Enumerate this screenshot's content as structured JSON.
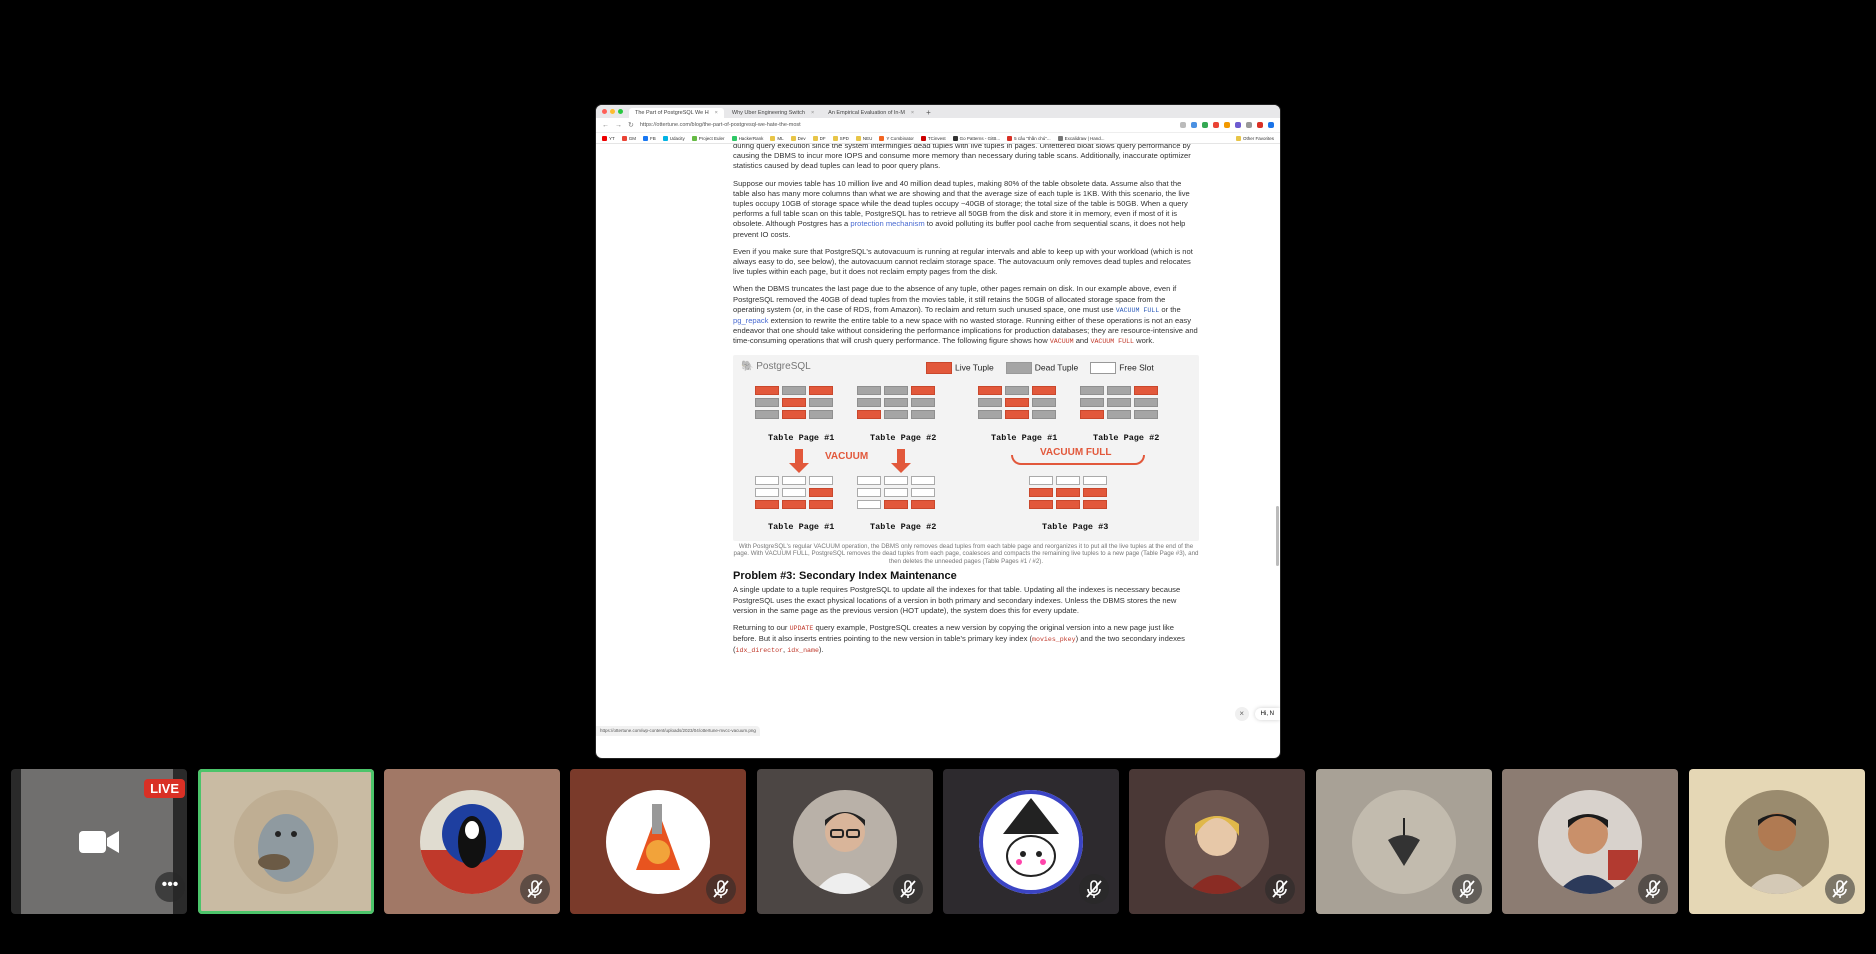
{
  "browser": {
    "tabs": [
      {
        "label": "The Part of PostgreSQL We H",
        "active": true
      },
      {
        "label": "Why Uber Engineering Switch",
        "active": false
      },
      {
        "label": "An Empirical Evaluation of In-M",
        "active": false
      }
    ],
    "new_tab": "+",
    "url": "https://ottertune.com/blog/the-part-of-postgresql-we-hate-the-most",
    "bookmarks": [
      "YT",
      "GM",
      "FB",
      "Udacity",
      "Project Euler",
      "HackerRank",
      "ML",
      "Dev",
      "DF",
      "SPD",
      "NEU",
      "Y Combinator",
      "TCinvest",
      "Go Patterns - GitB...",
      "5 câu \"thần chú\"...",
      "Excalidraw | Hand...",
      "Other Favorites"
    ],
    "status_url": "https://ottertune.com/wp-content/uploads/2023/04/ottertune-mvcc-vacuum.png",
    "toast_text": "Hi, N",
    "toast_close": "×"
  },
  "article": {
    "p1": "during query execution since the system intermingles dead tuples with live tuples in pages. Unfettered bloat slows query performance by causing the DBMS to incur more IOPS and consume more memory than necessary during table scans. Additionally, inaccurate optimizer statistics caused by dead tuples can lead to poor query plans.",
    "p2a": "Suppose our movies table has 10 million live and 40 million dead tuples, making 80% of the table obsolete data. Assume also that the table also has many more columns than what we are showing and that the average size of each tuple is 1KB. With this scenario, the live tuples occupy 10GB of storage space while the dead tuples occupy ~40GB of storage; the total size of the table is 50GB. When a query performs a full table scan on this table, PostgreSQL has to retrieve all 50GB from the disk and store it in memory, even if most of it is obsolete. Although Postgres has a ",
    "p2link": "protection mechanism",
    "p2b": " to avoid polluting its buffer pool cache from sequential scans, it does not help prevent IO costs.",
    "p3": "Even if you make sure that PostgreSQL's autovacuum is running at regular intervals and able to keep up with your workload (which is not always easy to do, see below), the autovacuum cannot reclaim storage space. The autovacuum only removes dead tuples and relocates live tuples within each page, but it does not reclaim empty pages from the disk.",
    "p4a": "When the DBMS truncates the last page due to the absence of any tuple, other pages remain on disk. In our example above, even if PostgreSQL removed the 40GB of dead tuples from the movies table, it still retains the 50GB of allocated storage space from the operating system (or, in the case of RDS, from Amazon). To reclaim and return such unused space, one must use ",
    "p4code1": "VACUUM FULL",
    "p4b": " or the ",
    "p4link": "pg_repack",
    "p4c": " extension to rewrite the entire table to a new space with no wasted storage. Running either of these operations is not an easy endeavor that one should take without considering the performance implications for production databases; they are resource-intensive and time-consuming operations that will crush query performance. The following figure shows how ",
    "p4code2": "VACUUM",
    "p4d": " and ",
    "p4code3": "VACUUM FULL",
    "p4e": " work.",
    "figure": {
      "logo": "PostgreSQL",
      "legend_live": "Live Tuple",
      "legend_dead": "Dead Tuple",
      "legend_free": "Free Slot",
      "label_tp1": "Table Page #1",
      "label_tp2": "Table Page #2",
      "label_tp3": "Table Page #3",
      "vacuum": "VACUUM",
      "vacuum_full": "VACUUM FULL",
      "colors": {
        "live": "#e2583b",
        "dead": "#a5a5a5",
        "free": "#ffffff"
      }
    },
    "caption": "With PostgreSQL's regular VACUUM operation, the DBMS only removes dead tuples from each table page and reorganizes it to put all the live tuples at the end of the page. With VACUUM FULL, PostgreSQL removes the dead tuples from each page, coalesces and compacts the remaining live tuples to a new page (Table Page #3), and then deletes the unneeded pages (Table Pages #1 / #2).",
    "heading": "Problem #3: Secondary Index Maintenance",
    "p5": "A single update to a tuple requires PostgreSQL to update all the indexes for that table. Updating all the indexes is necessary because PostgreSQL uses the exact physical locations of a version in both primary and secondary indexes. Unless the DBMS stores the new version in the same page as the previous version (HOT update), the system does this for every update.",
    "p6a": "Returning to our ",
    "p6code1": "UPDATE",
    "p6b": " query example, PostgreSQL creates a new version by copying the original version into a new page just like before. But it also inserts entries pointing to the new version in table's primary key index (",
    "p6code2": "movies_pkey",
    "p6c": ") and the two secondary indexes (",
    "p6code3": "idx_director",
    "p6d": ", ",
    "p6code4": "idx_name",
    "p6e": ")."
  },
  "participants": {
    "live_badge": "LIVE",
    "more": "•••",
    "tiles": [
      {
        "kind": "screen-preview",
        "bg": "#2a2a2a"
      },
      {
        "kind": "mascot",
        "bg": "#c9bba3",
        "speaking": true
      },
      {
        "kind": "anime-ghost",
        "bg": "#a17866"
      },
      {
        "kind": "chainsaw-dog",
        "bg": "#7a3a2a"
      },
      {
        "kind": "person-glasses",
        "bg": "#4c4644"
      },
      {
        "kind": "wizard-cat",
        "bg": "#2d2a2e"
      },
      {
        "kind": "anime-alchemist",
        "bg": "#4a3836"
      },
      {
        "kind": "spinning-top",
        "bg": "#a8a196"
      },
      {
        "kind": "person-selfie",
        "bg": "#8c7c72"
      },
      {
        "kind": "person-outdoor",
        "bg": "#e5d7b5"
      }
    ]
  }
}
